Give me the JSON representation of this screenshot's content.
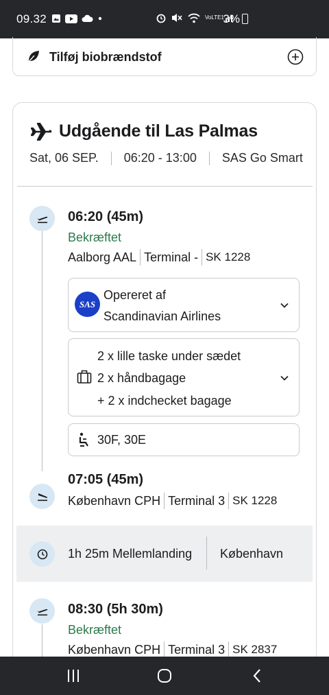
{
  "status_bar": {
    "time": "09.32",
    "battery": "3%",
    "network": "VoLTE1"
  },
  "biofuel": {
    "label": "Tilføj biobrændstof",
    "icon": "leaf-icon",
    "action_icon": "plus-circle-icon"
  },
  "flight": {
    "title": "Udgående til Las Palmas",
    "date": "Sat, 06 SEP.",
    "time_range": "06:20 - 13:00",
    "fare": "SAS Go Smart",
    "segments": [
      {
        "time": "06:20 (45m)",
        "status": "Bekræftet",
        "airport": "Aalborg AAL",
        "terminal": "Terminal -",
        "flight_no": "SK 1228"
      },
      {
        "time": "07:05 (45m)",
        "airport": "København CPH",
        "terminal": "Terminal 3",
        "flight_no": "SK 1228"
      },
      {
        "time": "08:30 (5h 30m)",
        "status": "Bekræftet",
        "airport": "København CPH",
        "terminal": "Terminal 3",
        "flight_no": "SK 2837"
      }
    ],
    "operator": {
      "line1": "Opereret af",
      "line2": "Scandinavian Airlines",
      "logo_text": "SAS"
    },
    "baggage": {
      "line1": "2 x lille taske under sædet",
      "line2": "2 x håndbagage",
      "line3": "+ 2 x indchecket bagage"
    },
    "seats": "30F, 30E",
    "layover": {
      "duration": "1h 25m Mellemlanding",
      "city": "København"
    }
  },
  "colors": {
    "status_green": "#2b7a4b",
    "timeline_circle": "#d7e7f3",
    "sas_blue": "#1a3fc8",
    "system_bar": "#25272b"
  }
}
